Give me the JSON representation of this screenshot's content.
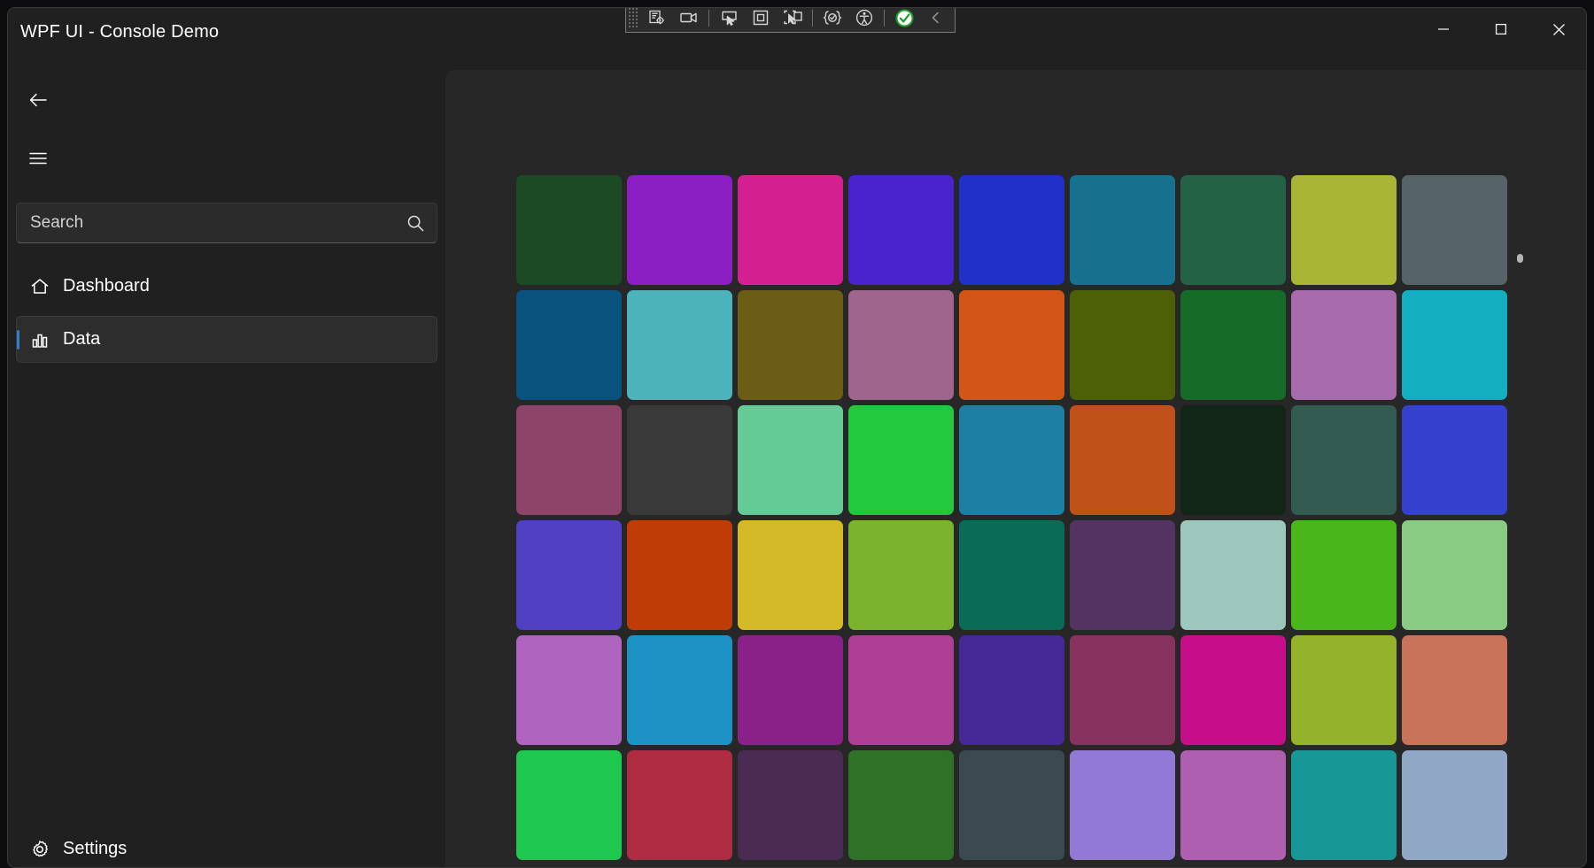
{
  "window": {
    "title": "WPF UI - Console Demo",
    "controls": [
      {
        "name": "minimize",
        "glyph": "—"
      },
      {
        "name": "maximize",
        "glyph": "□"
      },
      {
        "name": "close",
        "glyph": "✕"
      }
    ]
  },
  "vs_toolbar": {
    "items": [
      {
        "name": "go-to-live-visual-tree-icon"
      },
      {
        "name": "record-icon"
      },
      {
        "name": "select-element-icon"
      },
      {
        "name": "display-layout-adorner-icon"
      },
      {
        "name": "track-focused-element-icon"
      },
      {
        "name": "xaml-binding-failures-icon"
      },
      {
        "name": "accessibility-checker-icon"
      },
      {
        "name": "status-ok-icon"
      },
      {
        "name": "collapse-toolbar-icon",
        "glyph": "‹"
      }
    ]
  },
  "sidebar": {
    "back_button": {
      "name": "back-icon"
    },
    "hamburger_button": {
      "name": "hamburger-icon"
    },
    "search": {
      "placeholder": "Search",
      "value": "",
      "icon": "search-icon"
    },
    "items": [
      {
        "label": "Dashboard",
        "icon": "home-icon",
        "selected": false
      },
      {
        "label": "Data",
        "icon": "bar-chart-icon",
        "selected": true
      }
    ],
    "footer_items": [
      {
        "label": "Settings",
        "icon": "gear-icon",
        "selected": false
      }
    ],
    "accent_color": "#2f7fd1"
  },
  "content": {
    "grid": {
      "columns": 9,
      "rows": 6,
      "tile_colors": [
        [
          "#1c4a24",
          "#8b1fc4",
          "#d41f90",
          "#4b23ce",
          "#2030c8",
          "#16718f",
          "#236244",
          "#a9b534",
          "#556468"
        ],
        [
          "#0a527e",
          "#4cb3ba",
          "#6b5c16",
          "#a0658d",
          "#d45617",
          "#4d6008",
          "#156b27",
          "#a86bae",
          "#13aec0"
        ],
        [
          "#8e4468",
          "#3a3a3a",
          "#65cb96",
          "#22c93f",
          "#1c7fa3",
          "#bf5119",
          "#122617",
          "#335b52",
          "#3441ce"
        ],
        [
          "#5140c2",
          "#c03c06",
          "#d4ba26",
          "#7bb42c",
          "#0a6c57",
          "#533360",
          "#9dc7bc",
          "#49b71c",
          "#87cc82"
        ],
        [
          "#af65c0",
          "#1d92c4",
          "#8a2189",
          "#af3e96",
          "#472897",
          "#87325f",
          "#c60e8a",
          "#94b22a",
          "#c97459"
        ],
        [
          "#1ec850",
          "#ae2b42",
          "#4a2b51",
          "#2f7227",
          "#3b4a50",
          "#9279d6",
          "#af5faf",
          "#179896",
          "#90a8c6"
        ]
      ]
    },
    "scroll_indicator": {
      "name": "scroll-thumb"
    }
  }
}
